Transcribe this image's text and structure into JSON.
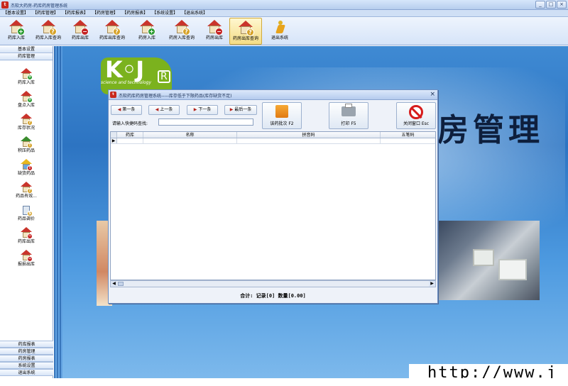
{
  "app": {
    "title": "杰软大药房-药库药房管理系统",
    "icon_text": "t"
  },
  "window_controls": {
    "minimize": "_",
    "maximize": "□",
    "close": "×"
  },
  "menu": [
    "【基本设置】",
    "【药库管理】",
    "【药库报表】",
    "【药房管理】",
    "【药房报表】",
    "【系统设置】",
    "【退出系统】"
  ],
  "toolbar": [
    {
      "label": "药库入库",
      "icon": "house-plus-icon",
      "badge": "+"
    },
    {
      "label": "药库入库查询",
      "icon": "house-search-icon",
      "badge": "?"
    },
    {
      "label": "药库出库",
      "icon": "house-minus-icon",
      "badge": "−"
    },
    {
      "label": "药库出库查询",
      "icon": "house-search-icon",
      "badge": "?"
    },
    {
      "label": "药房入库",
      "icon": "house-plus-icon",
      "badge": "+"
    },
    {
      "label": "药房入库查询",
      "icon": "house-search-icon",
      "badge": "?"
    },
    {
      "label": "药房出库",
      "icon": "house-minus-icon",
      "badge": "−"
    },
    {
      "label": "药房出库查询",
      "icon": "house-search-icon",
      "badge": "?",
      "active": true
    },
    {
      "label": "退出系统",
      "icon": "exit-runner-icon"
    }
  ],
  "sidebar": {
    "top_headers": [
      "基本设置",
      "药库管理"
    ],
    "items": [
      {
        "label": "药库入库",
        "icon": "house-plus-icon",
        "badge": "+"
      },
      {
        "label": "盘点入库",
        "icon": "house-plus-icon",
        "badge": "+"
      },
      {
        "label": "库存状况",
        "icon": "house-search-icon",
        "badge": "?"
      },
      {
        "label": "积压药品",
        "icon": "house-warning-icon",
        "badge": "!"
      },
      {
        "label": "缺货药品",
        "icon": "warning-icon",
        "badge": "!"
      },
      {
        "label": "药品有效...",
        "icon": "house-clock-icon",
        "badge": "?"
      },
      {
        "label": "药品调价",
        "icon": "price-adjust-icon",
        "badge": "$"
      },
      {
        "label": "药库出库",
        "icon": "house-minus-icon",
        "badge": "−"
      },
      {
        "label": "报损出库",
        "icon": "house-minus-icon",
        "badge": "−"
      }
    ],
    "bottom_headers": [
      "药库报表",
      "药房管理",
      "药房报表",
      "系统设置",
      "退出系统"
    ]
  },
  "desktop": {
    "logo_letters": "K◦J",
    "logo_r": "R",
    "logo_tagline": "science and technology",
    "big_title": "房管理",
    "url_fragment": "http://www.j"
  },
  "dialog": {
    "title": "杰软药库药房管理系统-----库存低于下限药品(库存缺货不足)",
    "close": "×",
    "nav": [
      {
        "label": "第一条",
        "arrow": "◀"
      },
      {
        "label": "上一条",
        "arrow": "◀"
      },
      {
        "label": "下一条",
        "arrow": "▶"
      },
      {
        "label": "最后一条",
        "arrow": "▶"
      }
    ],
    "buttons": {
      "batch": "该药批次 F2",
      "print": "打印 F5",
      "close": "关闭窗口 Esc"
    },
    "search": {
      "label": "请输入快捷码查找:",
      "value": ""
    },
    "columns": [
      "药库",
      "名称",
      "拼音码",
      "五笔码"
    ],
    "row_indicator": "▶",
    "scroll_left": "◀",
    "scroll_right": "▶",
    "summary": "合计: 记录[0] 数量[0.00]"
  },
  "colors": {
    "menu_bg": "#cfdff5",
    "desktop_blue": "#2d74c2",
    "active_tab": "#f3dc86",
    "danger_red": "#d61c1c"
  }
}
